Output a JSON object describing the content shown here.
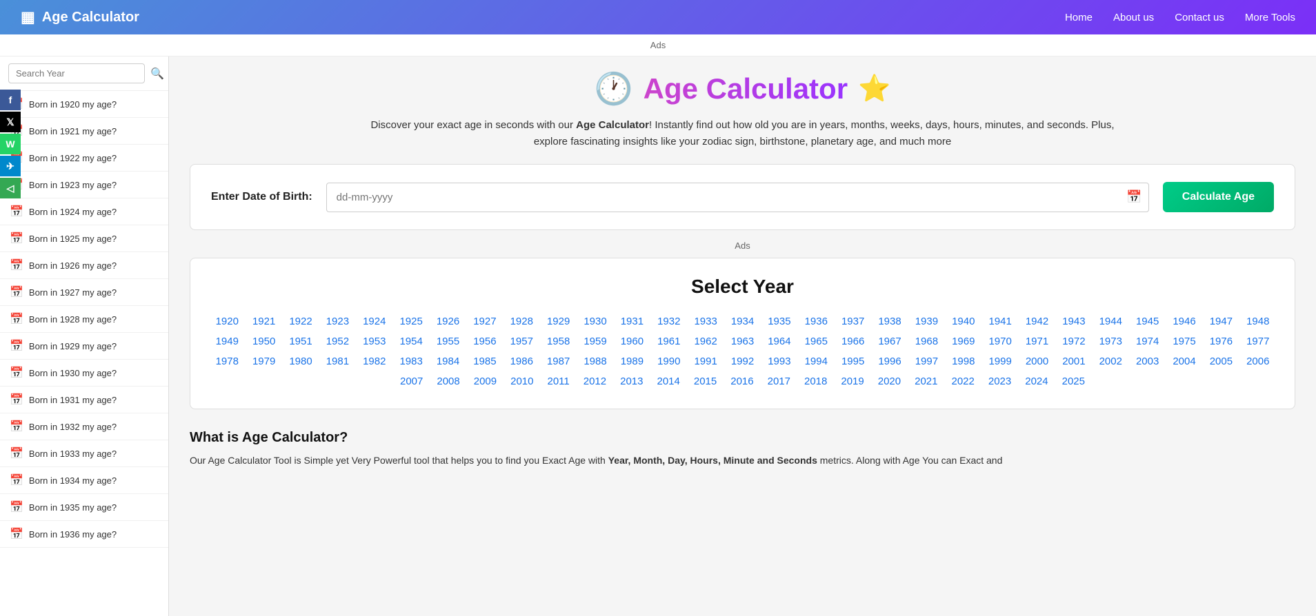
{
  "navbar": {
    "brand_icon": "▦",
    "brand_name": "Age Calculator",
    "links": [
      {
        "label": "Home",
        "name": "home-link"
      },
      {
        "label": "About us",
        "name": "about-link"
      },
      {
        "label": "Contact us",
        "name": "contact-link"
      },
      {
        "label": "More Tools",
        "name": "more-tools-link"
      }
    ]
  },
  "ads": {
    "label": "Ads"
  },
  "sidebar": {
    "search_placeholder": "Search Year",
    "items": [
      "Born in 1920 my age?",
      "Born in 1921 my age?",
      "Born in 1922 my age?",
      "Born in 1923 my age?",
      "Born in 1924 my age?",
      "Born in 1925 my age?",
      "Born in 1926 my age?",
      "Born in 1927 my age?",
      "Born in 1928 my age?",
      "Born in 1929 my age?",
      "Born in 1930 my age?",
      "Born in 1931 my age?",
      "Born in 1932 my age?",
      "Born in 1933 my age?",
      "Born in 1934 my age?",
      "Born in 1935 my age?",
      "Born in 1936 my age?"
    ]
  },
  "social": [
    {
      "label": "f",
      "class": "social-fb",
      "name": "facebook-share"
    },
    {
      "label": "𝕏",
      "class": "social-tw",
      "name": "twitter-share"
    },
    {
      "label": "W",
      "class": "social-wa",
      "name": "whatsapp-share"
    },
    {
      "label": "✈",
      "class": "social-tg",
      "name": "telegram-share"
    },
    {
      "label": "◁",
      "class": "social-sh",
      "name": "share-button"
    }
  ],
  "hero": {
    "title": "Age Calculator",
    "description_start": "Discover your exact age in seconds with our ",
    "description_bold": "Age Calculator",
    "description_end": "! Instantly find out how old you are in years, months, weeks, days, hours, minutes, and seconds. Plus, explore fascinating insights like your zodiac sign, birthstone, planetary age, and much more"
  },
  "date_input": {
    "label": "Enter Date of Birth:",
    "placeholder": "dd-mm-yyyy",
    "button_label": "Calculate Age"
  },
  "year_selector": {
    "title": "Select Year",
    "years": [
      1920,
      1921,
      1922,
      1923,
      1924,
      1925,
      1926,
      1927,
      1928,
      1929,
      1930,
      1931,
      1932,
      1933,
      1934,
      1935,
      1936,
      1937,
      1938,
      1939,
      1940,
      1941,
      1942,
      1943,
      1944,
      1945,
      1946,
      1947,
      1948,
      1949,
      1950,
      1951,
      1952,
      1953,
      1954,
      1955,
      1956,
      1957,
      1958,
      1959,
      1960,
      1961,
      1962,
      1963,
      1964,
      1965,
      1966,
      1967,
      1968,
      1969,
      1970,
      1971,
      1972,
      1973,
      1974,
      1975,
      1976,
      1977,
      1978,
      1979,
      1980,
      1981,
      1982,
      1983,
      1984,
      1985,
      1986,
      1987,
      1988,
      1989,
      1990,
      1991,
      1992,
      1993,
      1994,
      1995,
      1996,
      1997,
      1998,
      1999,
      2000,
      2001,
      2002,
      2003,
      2004,
      2005,
      2006,
      2007,
      2008,
      2009,
      2010,
      2011,
      2012,
      2013,
      2014,
      2015,
      2016,
      2017,
      2018,
      2019,
      2020,
      2021,
      2022,
      2023,
      2024,
      2025
    ]
  },
  "what_section": {
    "title": "What is Age Calculator?",
    "description": "Our Age Calculator Tool is Simple yet Very Powerful tool that helps you to find you Exact Age with ",
    "description_bold": "Year, Month, Day, Hours, Minute and Seconds",
    "description_end": " metrics. Along with Age You can Exact and"
  }
}
